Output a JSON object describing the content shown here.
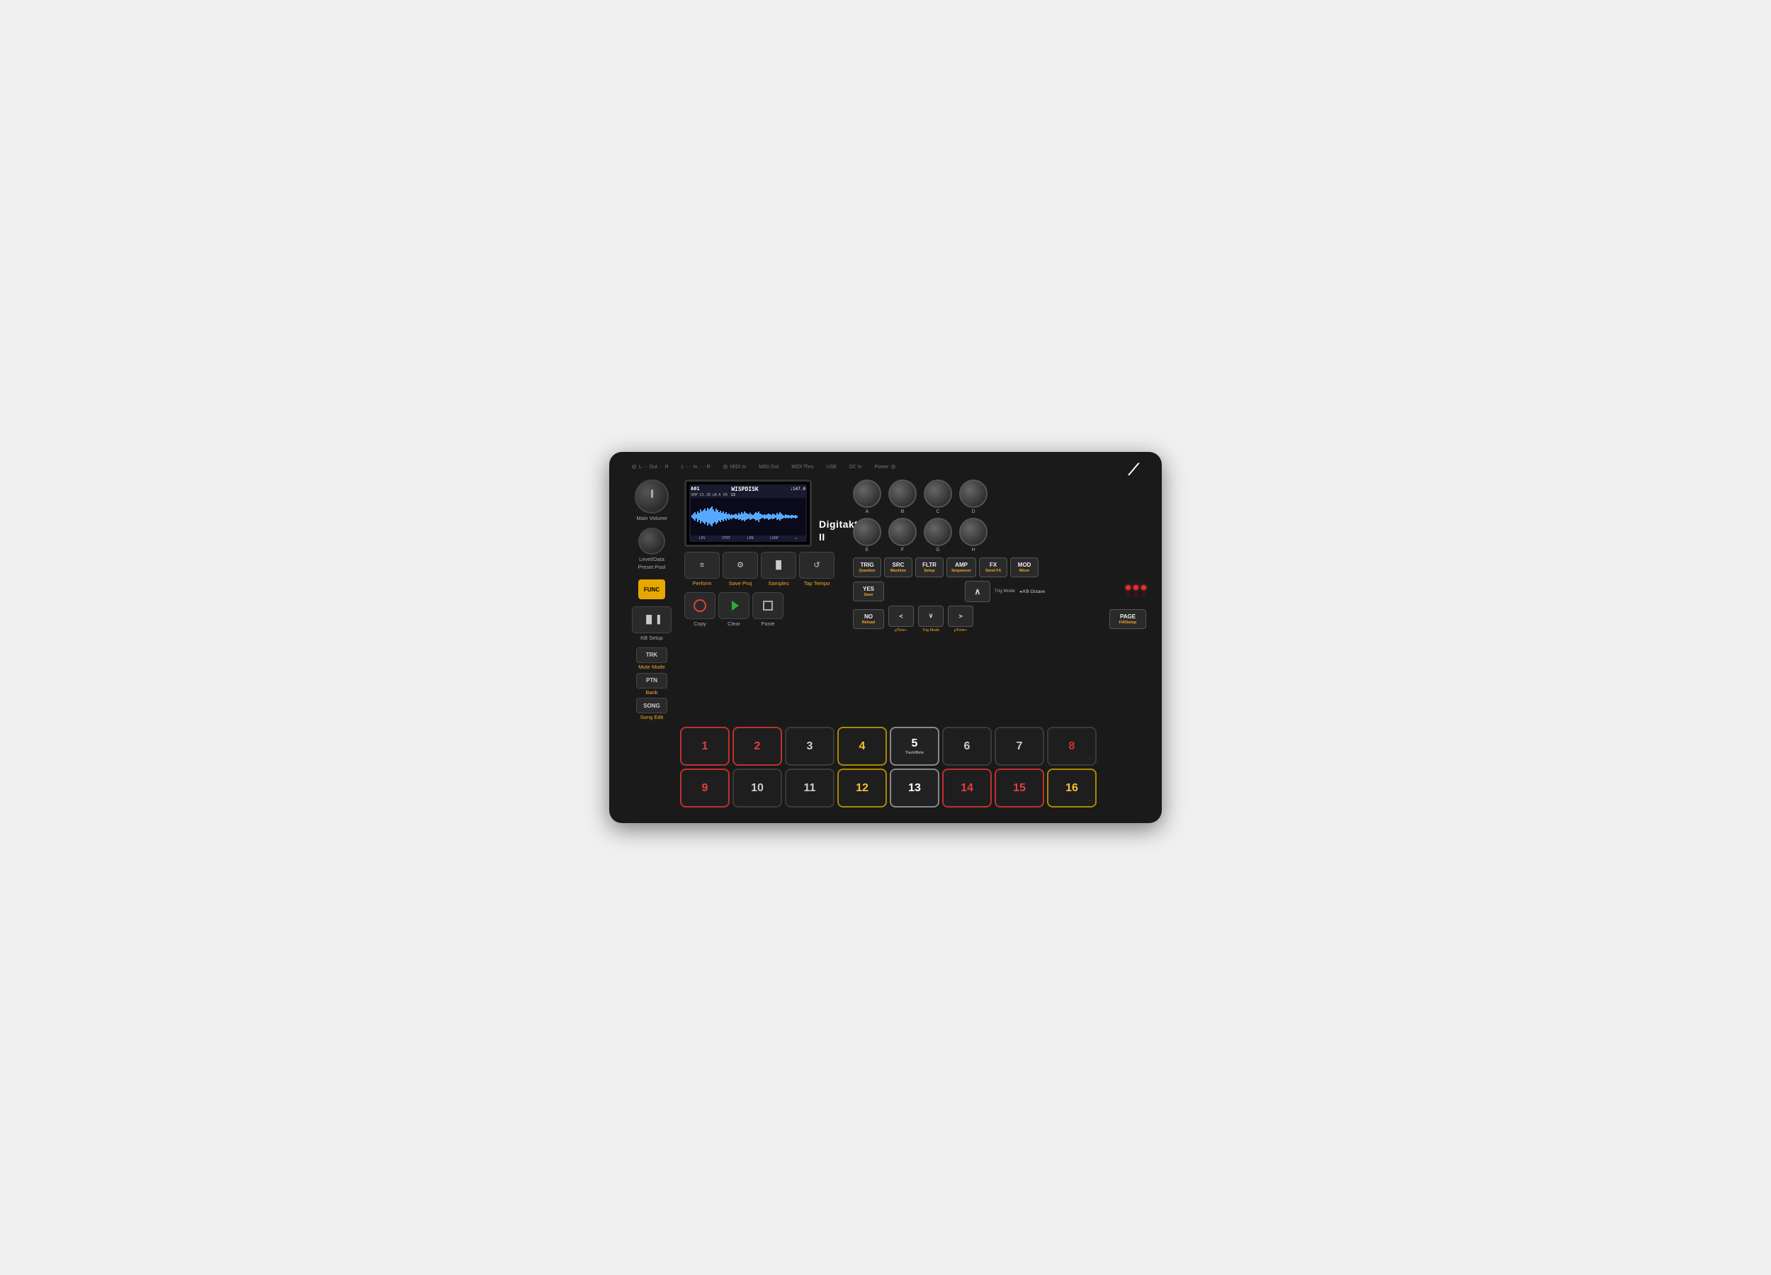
{
  "device": {
    "name": "Digitakt II",
    "brand": "Digitakt II"
  },
  "topBar": {
    "connectors": [
      "L ··· Out ··· R",
      "L ···· In ···· R",
      "MIDI In",
      "MIDI Out",
      "MIDI Thru",
      "USB",
      "DC In",
      "Power"
    ]
  },
  "screen": {
    "track": "A01",
    "sampleName": "WISPDISK",
    "bpm": "♩147.0",
    "row2": [
      "SMP",
      "13.3E",
      "◎R",
      "A 05"
    ],
    "row3": "13",
    "bottomLabels": [
      "LEV",
      "STRT",
      "LEN",
      "LOOP"
    ]
  },
  "leftPanel": {
    "mainVolumeLabel": "Main Volume",
    "levelDataLabel": "Level/Data",
    "presetPoolLabel": "Preset Pool"
  },
  "funcButton": "FUNC",
  "topButtons": [
    {
      "icon": "≡",
      "label": "Perform"
    },
    {
      "icon": "⚙",
      "label": "Save Proj"
    },
    {
      "icon": "▐▌▐",
      "label": "Samples"
    },
    {
      "icon": "↺",
      "label": "Tap Tempo"
    }
  ],
  "copyButton": "Copy",
  "clearButton": "Clear",
  "pasteButton": "Paste",
  "kbSetup": {
    "icon": "▐▌▐",
    "label": "KB Setup"
  },
  "sideButtons": [
    {
      "label": "TRK",
      "sub": "Mute Mode"
    },
    {
      "label": "PTN",
      "sub": "Bank"
    },
    {
      "label": "SONG",
      "sub": "Song Edit"
    }
  ],
  "rightKnobs": [
    {
      "label": "A"
    },
    {
      "label": "B"
    },
    {
      "label": "C"
    },
    {
      "label": "D"
    },
    {
      "label": "E"
    },
    {
      "label": "F"
    },
    {
      "label": "G"
    },
    {
      "label": "H"
    }
  ],
  "rightButtons": {
    "row1": [
      {
        "label": "TRIG",
        "sub": "Quantize"
      },
      {
        "label": "SRC",
        "sub": "Machine"
      },
      {
        "label": "FLTR",
        "sub": "Setup"
      },
      {
        "label": "AMP",
        "sub": "Sequencer"
      },
      {
        "label": "FX",
        "sub": "Send FX"
      },
      {
        "label": "MOD",
        "sub": "Mixer"
      }
    ],
    "row2_left": [
      {
        "label": "YES",
        "sub": "Save"
      },
      {
        "label": "NO",
        "sub": "Reload"
      }
    ],
    "trigMode": {
      "upBtn": "∧",
      "leftBtn": "<",
      "downBtn": "∨",
      "rightBtn": ">",
      "upSub": "Trig Mode",
      "leftSub": "µTime−",
      "downSub": "Trig Mode",
      "rightSub": "µTime+"
    },
    "kbOctave": "◂ KB Octave",
    "pageBtn": {
      "label": "PAGE",
      "sub": "Fill/Setup"
    }
  },
  "pads": {
    "row1": [
      {
        "num": "1",
        "state": "red"
      },
      {
        "num": "2",
        "state": "red"
      },
      {
        "num": "3",
        "state": "normal"
      },
      {
        "num": "4",
        "state": "yellow"
      },
      {
        "num": "5",
        "state": "selected"
      },
      {
        "num": "6",
        "state": "normal"
      },
      {
        "num": "7",
        "state": "normal"
      },
      {
        "num": "8",
        "state": "red-dot"
      }
    ],
    "row2": [
      {
        "num": "9",
        "state": "red"
      },
      {
        "num": "10",
        "state": "normal"
      },
      {
        "num": "11",
        "state": "normal"
      },
      {
        "num": "12",
        "state": "yellow"
      },
      {
        "num": "13",
        "state": "selected"
      },
      {
        "num": "14",
        "state": "red"
      },
      {
        "num": "15",
        "state": "red"
      },
      {
        "num": "16",
        "state": "yellow"
      }
    ],
    "trackMuteLabel": "Track/Mute"
  }
}
